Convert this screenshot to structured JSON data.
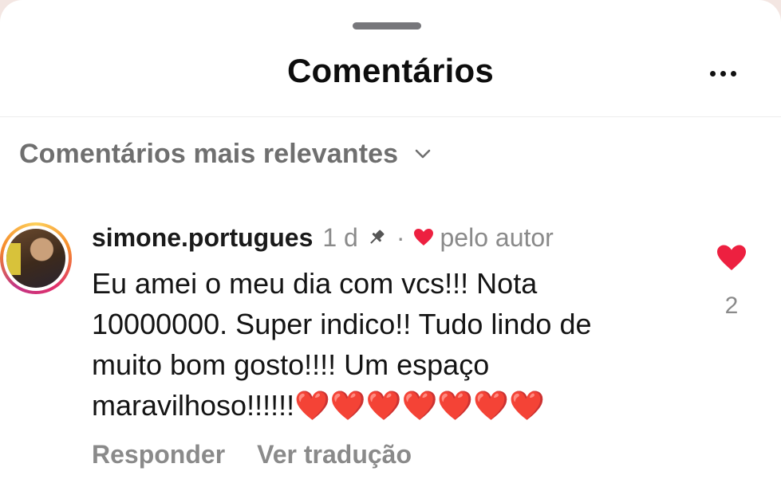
{
  "sheet": {
    "title": "Comentários",
    "sort_label": "Comentários mais relevantes"
  },
  "comment": {
    "username": "simone.portugues",
    "time": "1 d",
    "separator": "·",
    "author_like_label": "pelo autor",
    "text": "Eu amei o meu dia com vcs!!! Nota 10000000. Super indico!! Tudo lindo de muito bom gosto!!!! Um espaço maravilhoso!!!!!!❤️❤️❤️❤️❤️❤️❤️",
    "like_count": "2",
    "reply_label": "Responder",
    "translate_label": "Ver tradução"
  },
  "colors": {
    "heart": "#ed2040",
    "secondary_text": "#8a8a8a"
  },
  "icons": [
    "more-icon",
    "chevron-down-icon",
    "pin-icon",
    "heart-icon"
  ]
}
